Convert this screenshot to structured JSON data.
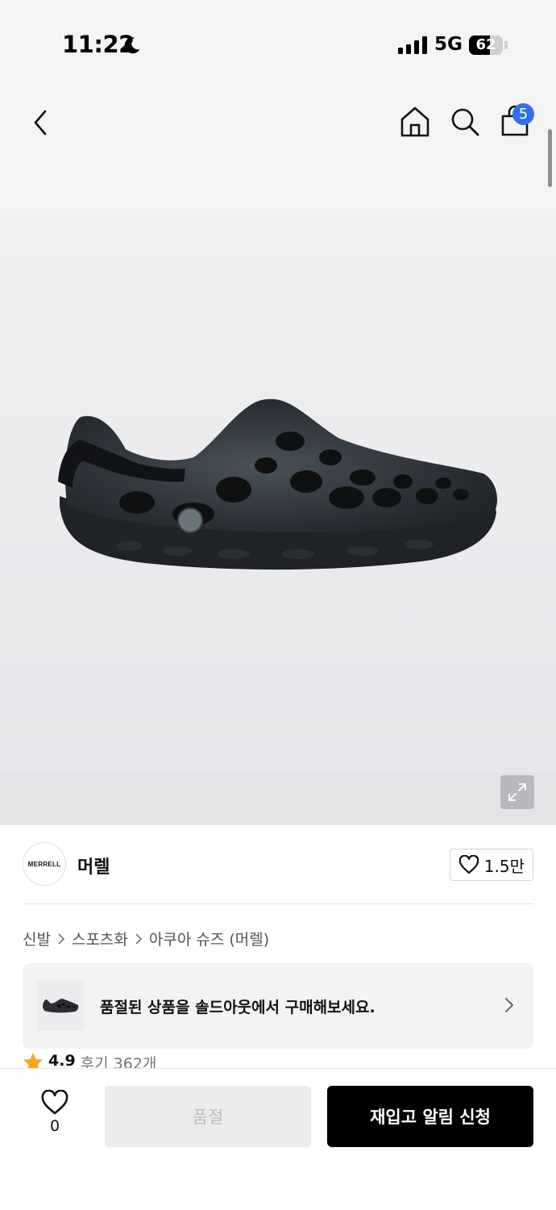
{
  "status_bar": {
    "time": "11:22",
    "network": "5G",
    "battery": "62",
    "battery_level": 0.62,
    "icons": [
      "moon-icon",
      "signal-icon",
      "battery-icon"
    ]
  },
  "nav": {
    "icons": [
      "back-arrow-icon",
      "home-icon",
      "search-icon",
      "shopping-bag-icon"
    ],
    "cart_count": "5",
    "accent_color": "#2f6ff0"
  },
  "product_image": {
    "icons": [
      "expand-icon"
    ]
  },
  "brand": {
    "logo_text": "MERRELL",
    "name": "머렐",
    "like_count": "1.5만"
  },
  "breadcrumb": {
    "items": [
      "신발",
      "스포츠화",
      "아쿠아 슈즈 (머렐)"
    ]
  },
  "soldout_banner": {
    "text": "품절된 상품을 솔드아웃에서 구매해보세요."
  },
  "rating": {
    "score": "4.9",
    "reviews": "후기 362개",
    "star_color": "#f5a623"
  },
  "bottom_bar": {
    "wish_count": "0",
    "soldout_label": "품절",
    "restock_label": "재입고 알림 신청"
  }
}
